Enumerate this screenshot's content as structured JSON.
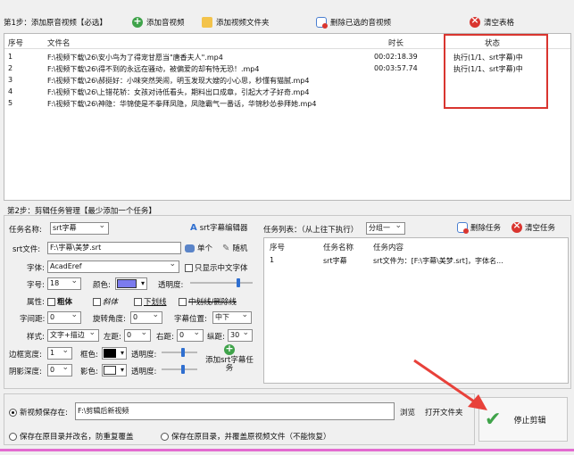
{
  "step1": {
    "label": "第1步：添加原音视频【必选】",
    "add_video": "添加音视频",
    "add_folder": "添加视频文件夹",
    "delete_selected": "删除已选的音视频",
    "clear_table": "清空表格",
    "columns": [
      "序号",
      "文件名",
      "时长",
      "状态"
    ],
    "rows": [
      {
        "no": "1",
        "file": "F:\\视频下载\\26\\安小鸟为了得宠甘愿当\"唐香夫人\".mp4",
        "duration": "00:02:18.39",
        "status": "执行(1/1、srt字幕)中"
      },
      {
        "no": "2",
        "file": "F:\\视频下载\\26\\得不到的永远在骚动，被偏爱的却有恃无恐！.mp4",
        "duration": "00:03:57.74",
        "status": "执行(1/1、srt字幕)中"
      },
      {
        "no": "3",
        "file": "F:\\视频下载\\26\\郝挺好：小味突然哭闹，明玉发现大嫂的小心思，秒懂有猫腻.mp4",
        "duration": "",
        "status": ""
      },
      {
        "no": "4",
        "file": "F:\\视频下载\\26\\上错花轿：女孩对诗低看头，期料出口成章，引起大才子好奇.mp4",
        "duration": "",
        "status": ""
      },
      {
        "no": "5",
        "file": "F:\\视频下载\\26\\神隐：华锦使是不拳拜凤隐，凤隐霸气一番话，华锦秒怂参拜她.mp4",
        "duration": "",
        "status": ""
      }
    ]
  },
  "step2": {
    "label": "第2步：剪辑任务管理【最少添加一个任务】",
    "task_name_label": "任务名称:",
    "task_name_value": "srt字幕",
    "srt_editor": "srt字幕编辑器",
    "srt_file_label": "srt文件:",
    "srt_file_value": "F:\\字幕\\美梦.srt",
    "single": "单个",
    "random": "随机",
    "font_label": "字体:",
    "font_value": "AcadEref",
    "only_chinese": "只显示中文字体",
    "size_label": "字号:",
    "size_value": "18",
    "color_label": "颜色:",
    "opacity_label": "透明度:",
    "attr_label": "属性:",
    "bold": "粗体",
    "italic": "斜体",
    "underline": "下划线",
    "strike": "中划线/删除线",
    "spacing_label": "字间距:",
    "spacing_value": "0",
    "rotate_label": "旋转角度:",
    "rotate_value": "0",
    "position_label": "字幕位置:",
    "position_value": "中下",
    "style_label": "样式:",
    "style_value": "文字+描边",
    "left_label": "左距:",
    "left_value": "0",
    "right_label": "右距:",
    "right_value": "0",
    "vert_label": "纵距:",
    "vert_value": "30",
    "border_label": "边框宽度:",
    "border_value": "1",
    "border_color_label": "框色:",
    "border_opacity_label": "透明度:",
    "shadow_label": "阴影深度:",
    "shadow_value": "0",
    "shadow_color_label": "影色:",
    "shadow_opacity_label": "透明度:",
    "add_task": "添加srt字幕任务",
    "task_list_label": "任务列表：（从上往下执行）",
    "group_value": "分组一",
    "delete_task": "删除任务",
    "clear_task": "清空任务",
    "task_columns": [
      "序号",
      "任务名称",
      "任务内容"
    ],
    "task_rows": [
      {
        "no": "1",
        "name": "srt字幕",
        "content": "srt文件为：[F:\\字幕\\美梦.srt]，字体名..."
      }
    ]
  },
  "output": {
    "save_label": "新视频保存在:",
    "save_path": "F:\\剪辑后新视频",
    "browse": "浏览",
    "open_folder": "打开文件夹",
    "opt_rename": "保存在原目录并改名，防重复覆盖",
    "opt_overwrite": "保存在原目录，并覆盖原视频文件（不能恢复）",
    "stop": "停止剪辑"
  },
  "colors": {
    "font_color": "#7b7bee",
    "border_color": "#000000",
    "shadow_color": "#ffffff",
    "highlight": "#d9352f",
    "arrow": "#e8413a",
    "progress": "#e36bd0"
  }
}
